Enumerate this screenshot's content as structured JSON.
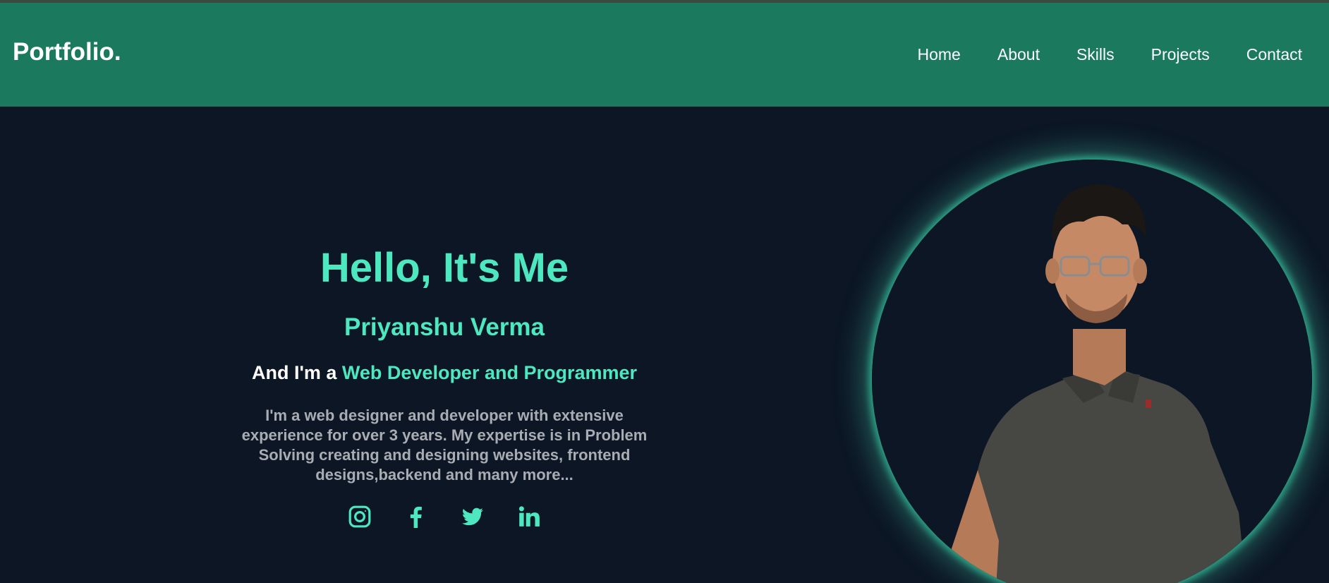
{
  "header": {
    "logo": "Portfolio.",
    "nav": [
      {
        "label": "Home"
      },
      {
        "label": "About"
      },
      {
        "label": "Skills"
      },
      {
        "label": "Projects"
      },
      {
        "label": "Contact"
      }
    ]
  },
  "hero": {
    "greeting": "Hello, It's Me",
    "name": "Priyanshu Verma",
    "role_prefix": "And I'm a ",
    "role_highlight": "Web Developer and Programmer",
    "bio": "I'm a web designer and developer with extensive experience for over 3 years. My expertise is in Problem Solving creating and designing websites, frontend designs,backend and many more...",
    "socials": [
      {
        "icon": "instagram-icon"
      },
      {
        "icon": "facebook-icon"
      },
      {
        "icon": "twitter-icon"
      },
      {
        "icon": "linkedin-icon"
      }
    ],
    "photo": {
      "icon": "profile-photo"
    }
  },
  "colors": {
    "header_bg": "#1b7a5e",
    "page_bg": "#0c1624",
    "accent": "#4de8bf",
    "bio_text": "#a9adb3"
  }
}
